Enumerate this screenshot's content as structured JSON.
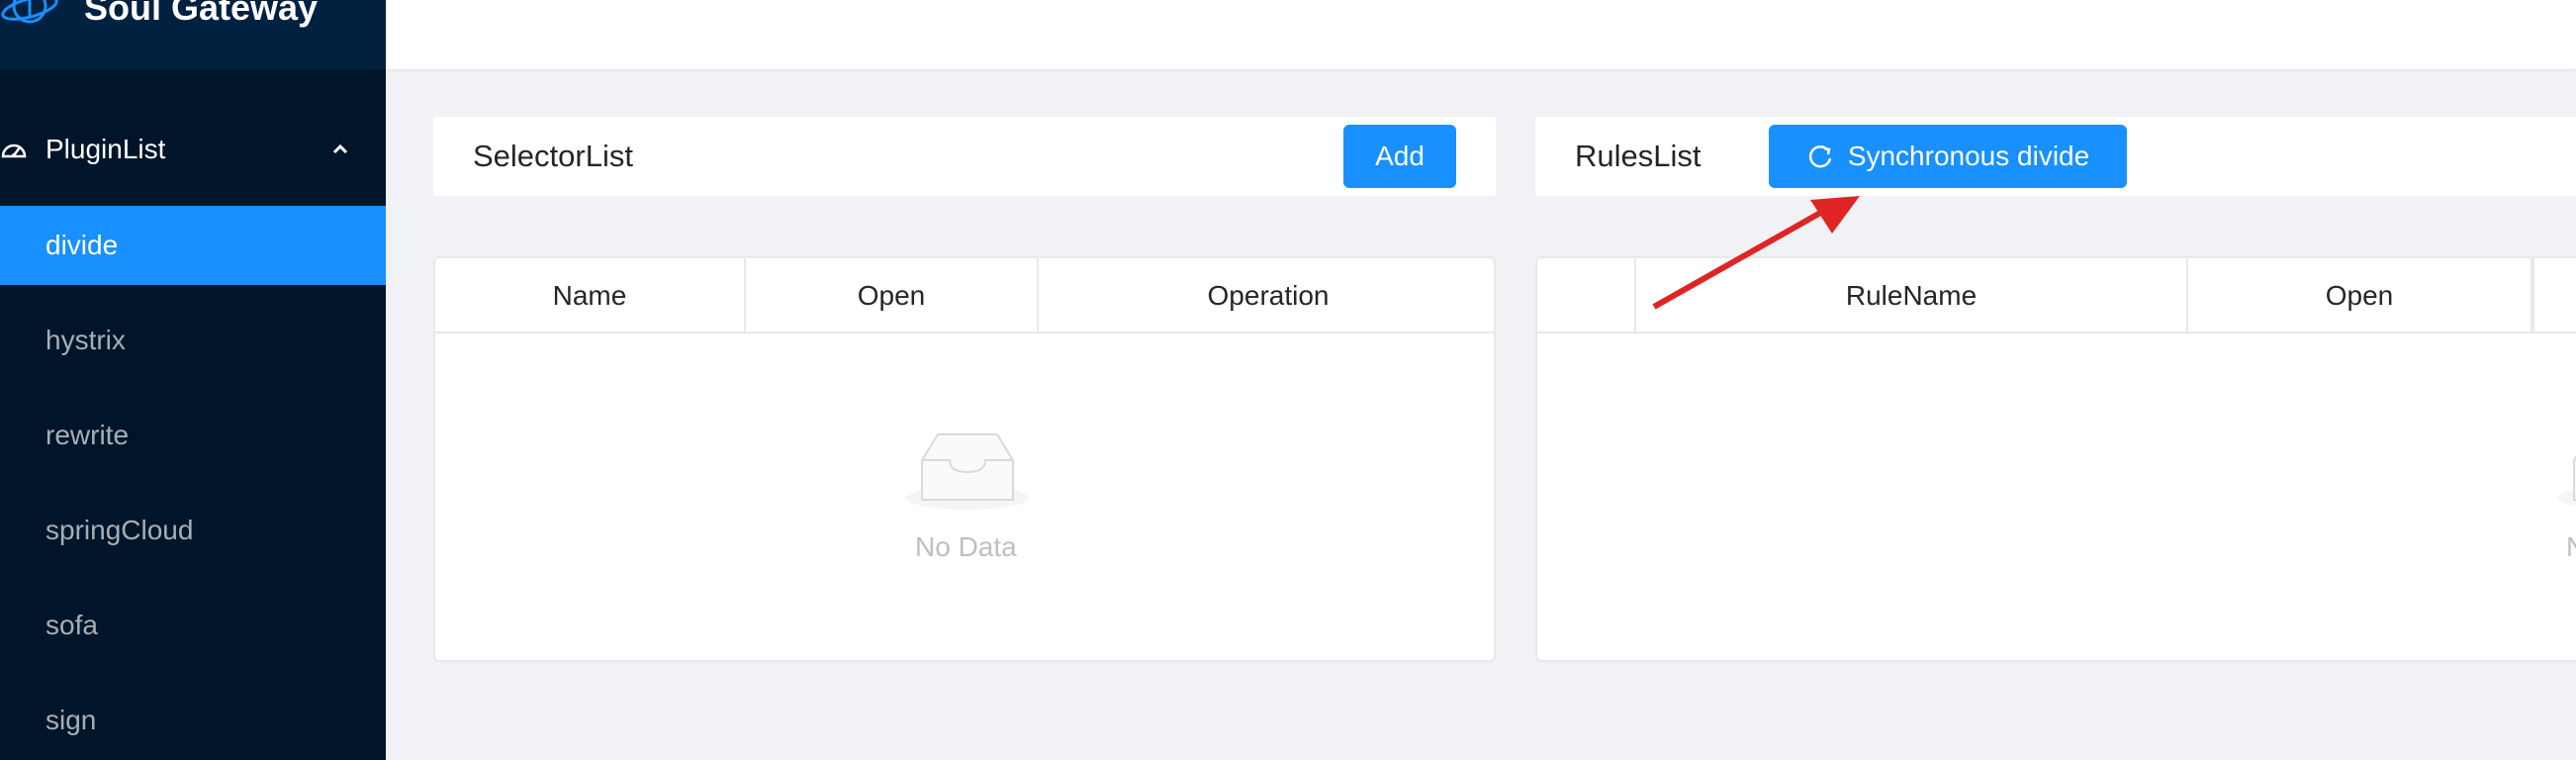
{
  "app": {
    "title": "Soul Gateway"
  },
  "sidebar": {
    "submenu": {
      "label": "PluginList",
      "icon": "dashboard-icon",
      "expanded": true
    },
    "items": [
      {
        "label": "divide",
        "active": true
      },
      {
        "label": "hystrix",
        "active": false
      },
      {
        "label": "rewrite",
        "active": false
      },
      {
        "label": "springCloud",
        "active": false
      },
      {
        "label": "sofa",
        "active": false
      },
      {
        "label": "sign",
        "active": false
      }
    ]
  },
  "selector_panel": {
    "title": "SelectorList",
    "add_label": "Add",
    "columns": [
      "Name",
      "Open",
      "Operation"
    ],
    "empty_text": "No Data"
  },
  "rules_panel": {
    "title": "RulesList",
    "sync_label": "Synchronous divide",
    "columns": [
      "",
      "RuleName",
      "Open"
    ],
    "empty_text": "No Data"
  },
  "colors": {
    "sidebar_bg": "#001529",
    "primary": "#1890ff",
    "annotation_arrow": "#e02424"
  }
}
